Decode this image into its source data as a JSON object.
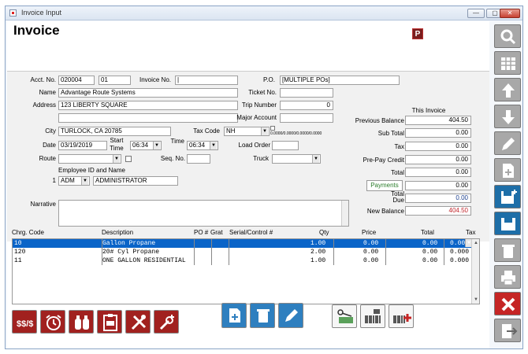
{
  "window": {
    "title": "Invoice Input",
    "min": "—",
    "max": "▢",
    "close": "✕"
  },
  "header": {
    "title": "Invoice",
    "badge": "P"
  },
  "form": {
    "acct_label": "Acct. No.",
    "acct_no": "020004",
    "acct_sub": "01",
    "invoice_label": "Invoice No.",
    "invoice_no": "|",
    "po_label": "P.O.",
    "po": "[MULTIPLE POs]",
    "name_label": "Name",
    "name": "Advantage Route Systems",
    "ticket_label": "Ticket No.",
    "ticket": "",
    "address_label": "Address",
    "address": "123 LIBERTY SQUARE",
    "address2": "",
    "trip_label": "Trip Number",
    "trip": "0",
    "major_label": "Major Account",
    "major": "",
    "city_label": "City",
    "city": "TURLOCK, CA  20785",
    "taxcode_label": "Tax Code",
    "taxcode": "NH",
    "taxrates": "0.0000/0.0000/0.0000/0.0000",
    "date_label": "Date",
    "date": "03/19/2019",
    "start_label1": "Start",
    "start_label2": "Time",
    "start_time": "06:34",
    "time_label": "Time",
    "time": "06:34",
    "load_label": "Load Order",
    "load": "",
    "route_label": "Route",
    "route": "",
    "seq_label": "Seq. No.",
    "seq": "",
    "truck_label": "Truck",
    "truck": "",
    "emp_header": "Employee ID and Name",
    "emp_num": "1",
    "emp_id": "ADM",
    "emp_name": "ADMINISTRATOR",
    "narrative_label": "Narrative",
    "narrative": ""
  },
  "totals": {
    "header": "This Invoice",
    "prev_label": "Previous Balance",
    "prev": "404.50",
    "sub_label": "Sub Total",
    "sub": "0.00",
    "tax_label": "Tax",
    "tax": "0.00",
    "prepay_label": "Pre-Pay Credit",
    "prepay": "0.00",
    "total_label": "Total",
    "total": "0.00",
    "payments_label": "Payments",
    "payments": "0.00",
    "due_label1": "Total",
    "due_label2": "Due",
    "due": "0.00",
    "newbal_label": "New Balance",
    "newbal": "404.50"
  },
  "grid": {
    "headers": [
      "Chrg. Code",
      "Description",
      "PO #",
      "Grat",
      "Serial/Control #",
      "Qty",
      "Price",
      "Total",
      "Tax"
    ],
    "rows": [
      [
        "10",
        "Gallon Propane",
        "1.00",
        "0.00",
        "0.00",
        "0.000"
      ],
      [
        "120",
        "20# Cyl Propane",
        "2.00",
        "0.00",
        "0.00",
        "0.000"
      ],
      [
        "11",
        "ONE GALLON RESIDENTIAL",
        "1.00",
        "0.00",
        "0.00",
        "0.000"
      ]
    ]
  },
  "icons": {
    "toolbar_left": [
      "dollar-swap-icon",
      "alarm-clock-icon",
      "propane-tanks-icon",
      "clipboard-money-icon",
      "tools-icon",
      "wrench-plus-icon"
    ],
    "toolbar_mid": [
      "new-document-icon",
      "delete-icon",
      "edit-icon"
    ],
    "toolbar_right": [
      "scissors-money-icon",
      "barcode-scanner-icon",
      "barcode-scanner-add-icon"
    ],
    "sidebar": [
      "search-icon",
      "grid-icon",
      "arrow-up-icon",
      "arrow-down-icon",
      "pencil-icon",
      "add-page-icon",
      "save-add-icon",
      "save-icon",
      "trash-icon",
      "print-icon",
      "cancel-icon",
      "exit-icon"
    ]
  },
  "colors": {
    "accent_red": "#a1211f",
    "select_blue": "#0a64c8",
    "sidebar_blue": "#1d6ea8",
    "sidebar_red": "#c52525",
    "newbal_red": "#c0262c"
  }
}
